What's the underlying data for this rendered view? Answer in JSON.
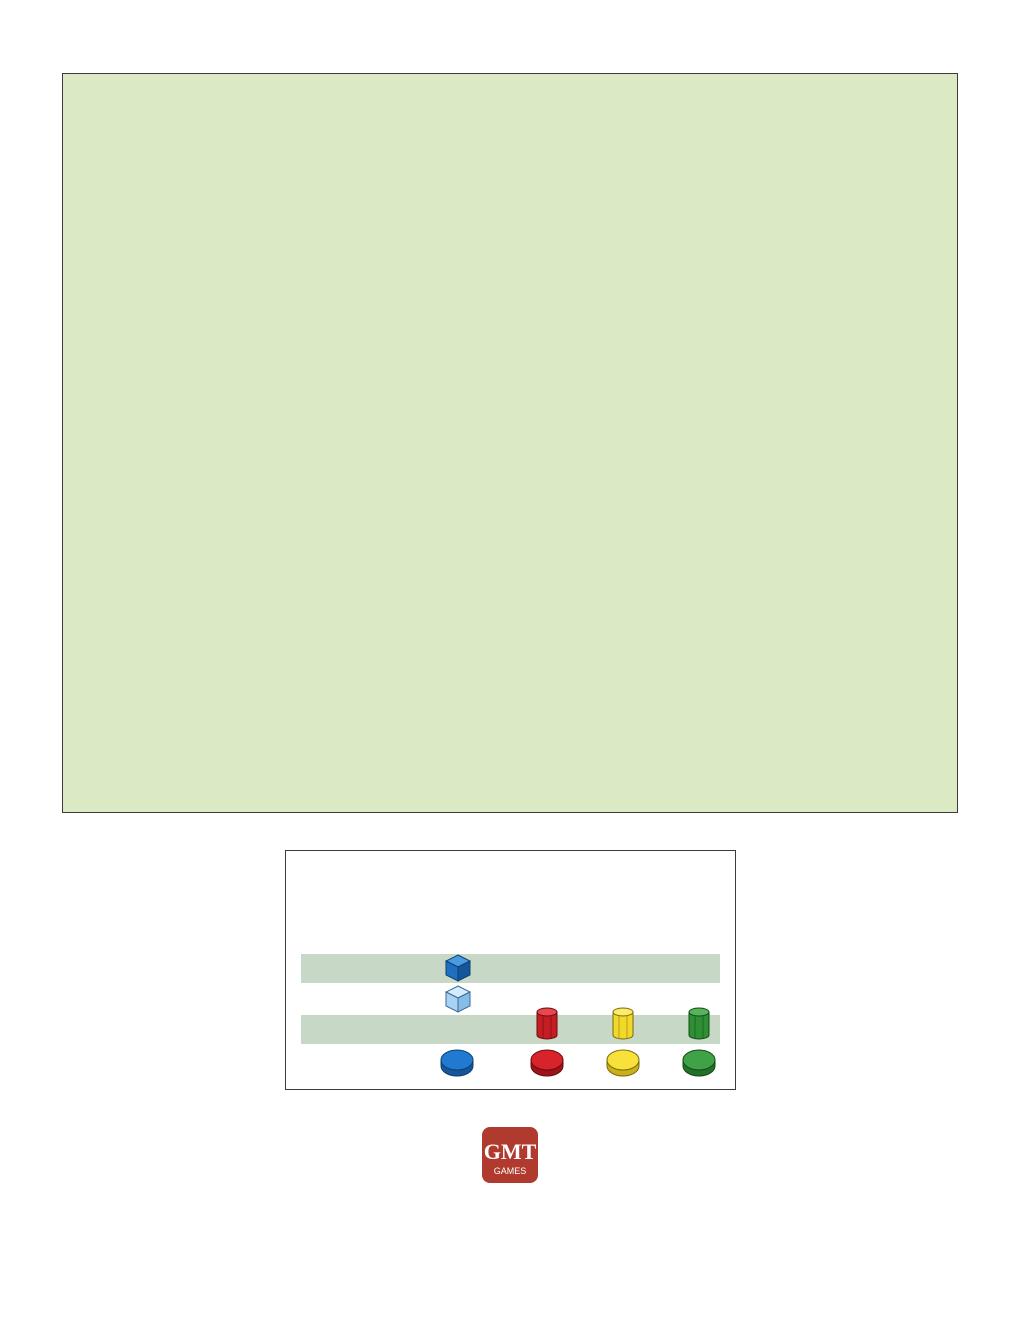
{
  "logo": {
    "text_main": "GMT",
    "text_sub": "GAMES",
    "color": "#b03a2e"
  },
  "colors": {
    "panel_bg": "#dce9c5",
    "band": "#c7d9c6",
    "blue": "#1f6fc1",
    "light_blue": "#a9d3f2",
    "red": "#d8232a",
    "yellow": "#f5e03a",
    "green": "#3a9a3a"
  },
  "legend": {
    "rows": [
      {
        "piece": "blue-cube"
      },
      {
        "piece": "light-blue-cube"
      },
      {
        "pieces": [
          "red-cylinder",
          "yellow-cylinder",
          "green-cylinder"
        ]
      },
      {
        "pieces": [
          "blue-disc",
          "red-disc",
          "yellow-disc",
          "green-disc"
        ]
      }
    ]
  }
}
